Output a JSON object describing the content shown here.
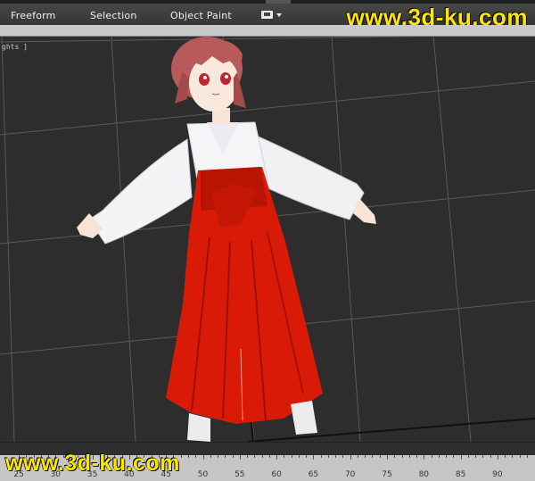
{
  "ribbon": {
    "tabs": [
      {
        "label": "Freeform"
      },
      {
        "label": "Selection"
      },
      {
        "label": "Object Paint"
      }
    ],
    "dropdown_icon": "dropdown-toggle-icon"
  },
  "watermark": {
    "top": "www.3d-ku.com",
    "bottom": "www.3d-ku.com"
  },
  "viewport": {
    "label": "ghts ]",
    "subject": "character-model-miko-outfit"
  },
  "timeline": {
    "ticks": [
      "25",
      "30",
      "35",
      "40",
      "45",
      "50",
      "55",
      "60",
      "65",
      "70",
      "75",
      "80",
      "85",
      "90"
    ]
  },
  "colors": {
    "hakama_red": "#d91a06",
    "haori_white": "#f2f2f4",
    "hair": "#b85a5a",
    "watermark_yellow": "#ffe600"
  }
}
